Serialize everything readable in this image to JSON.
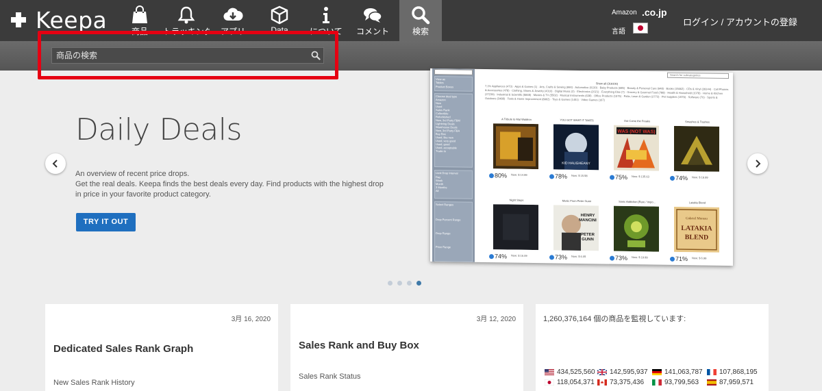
{
  "logo": {
    "text": "Keepa"
  },
  "nav": [
    {
      "label": "商品",
      "icon": "shopping-bag-icon"
    },
    {
      "label": "トラッキング",
      "icon": "bell-icon"
    },
    {
      "label": "アプリ",
      "icon": "cloud-download-icon"
    },
    {
      "label": "Data",
      "icon": "box-icon"
    },
    {
      "label": "について",
      "icon": "info-icon"
    },
    {
      "label": "コメント",
      "icon": "comments-icon"
    },
    {
      "label": "検索",
      "icon": "search-icon"
    }
  ],
  "locale": {
    "amazon_label": "Amazon",
    "domain": ".co.jp",
    "lang_label": "言語"
  },
  "login": {
    "label": "ログイン / アカウントの登録"
  },
  "search": {
    "placeholder": "商品の検索"
  },
  "hero": {
    "title": "Daily Deals",
    "desc": [
      "An overview of recent price drops.",
      "Get the real deals. Keepa finds the best deals every day. Find products with the highest drop",
      "in price in your favorite product category."
    ],
    "button": "TRY IT OUT"
  },
  "preview": {
    "search_placeholder": "Search for subcategories",
    "show_all": "Show all (319100)",
    "categories": "7,1% Appliances (473) · Apps & Games (1) · Arts, Crafts & Sewing (990) · Automotive (6130) · Baby Products (685) · Beauty & Personal Care (948) · Books (15662) · CDs & Vinyl (28144) · Cell Phones & Accessories (478) · Clothing, Shoes & Jewelry (4310) · Digital Music (2) · Electronics (2021) · Everything Else (7) · Grocery & Gourmet Food (788) · Health & Household (1078) · Home & Kitchen (27239) · Industrial & Scientific (5848) · Movies & TV (5502) · Musical Instruments (638) · Office Products (1575) · Patio, Lawn & Garden (2773) · Pet Supplies (1579) · Software (70) · Sports & Outdoors (3488) · Tools & Home Improvement (8962) · Toys & Games (1451) · Video Games (167)",
    "side": [
      "View as",
      "Tables",
      "Product Boxes",
      "Choose deal type",
      "Amazon",
      "New",
      "Used",
      "Sales Rank",
      "Collectible",
      "Refurbished",
      "New, 3rd Party FBM",
      "Lightning Deals",
      "Warehouse Deals",
      "New, 3rd Party FBA",
      "Buy Box",
      "Used, like new",
      "Used, very good",
      "Used, good",
      "Used, acceptable",
      "Trade-In",
      "Limit Drop Interval",
      "Day",
      "Week",
      "Month",
      "3 Months",
      "All",
      "Select Ranges",
      "Drop Percent Range",
      "Drop Range",
      "Price Range"
    ],
    "items": [
      {
        "title": "A Tribute to Mal Waldron",
        "pct": "80%",
        "now": "Now: $ 14.99"
      },
      {
        "title": "YOU GOT WHAT IT TAKES",
        "pct": "78%",
        "now": "Now: $ 15.58"
      },
      {
        "title": "Out Come the Freaks",
        "pct": "75%",
        "now": "Now: $ 135.63"
      },
      {
        "title": "Smashes & Trashes",
        "pct": "74%",
        "now": "Now: $ 19.99"
      },
      {
        "title": "Night Steps",
        "pct": "74%",
        "now": "Now: $ 16.09"
      },
      {
        "title": "Music From Peter Gunn",
        "pct": "73%",
        "now": "Now: $ 6.05"
      },
      {
        "title": "Sonic Addiction [Rare / Impo...",
        "pct": "73%",
        "now": "Now: $ 19.99"
      },
      {
        "title": "Latakia Blend",
        "pct": "71%",
        "now": "Now: $ 6.99"
      }
    ],
    "covers": {
      "peter_gunn": [
        "HENRY",
        "MANCINI",
        "PETER",
        "GUNN"
      ],
      "wasnotwas": "WAS (NOT WAS)",
      "latakia": [
        "Gabriel Moreau",
        "LATAKIA",
        "BLEND"
      ],
      "kid": "KID HAUGHEANY"
    }
  },
  "carousel": {
    "dots": 4,
    "active": 3
  },
  "cards": [
    {
      "date": "3月 16, 2020",
      "title": "Dedicated Sales Rank Graph",
      "sub": "New Sales Rank History"
    },
    {
      "date": "3月 12, 2020",
      "title": "Sales Rank and Buy Box",
      "sub": "Sales Rank Status"
    }
  ],
  "stats": {
    "title": "1,260,376,164 個の商品を監視しています:",
    "row1": [
      {
        "country": "us",
        "value": "434,525,560"
      },
      {
        "country": "uk",
        "value": "142,595,937"
      },
      {
        "country": "de",
        "value": "141,063,787"
      },
      {
        "country": "fr",
        "value": "107,868,195"
      }
    ],
    "row2": [
      {
        "country": "jp",
        "value": "118,054,371"
      },
      {
        "country": "ca",
        "value": "73,375,436"
      },
      {
        "country": "it",
        "value": "93,799,563"
      },
      {
        "country": "es",
        "value": "87,959,571"
      }
    ]
  },
  "colors": {
    "topbar": "#3b3b3b",
    "accent": "#1f6fbf",
    "highlight": "#e60012"
  }
}
